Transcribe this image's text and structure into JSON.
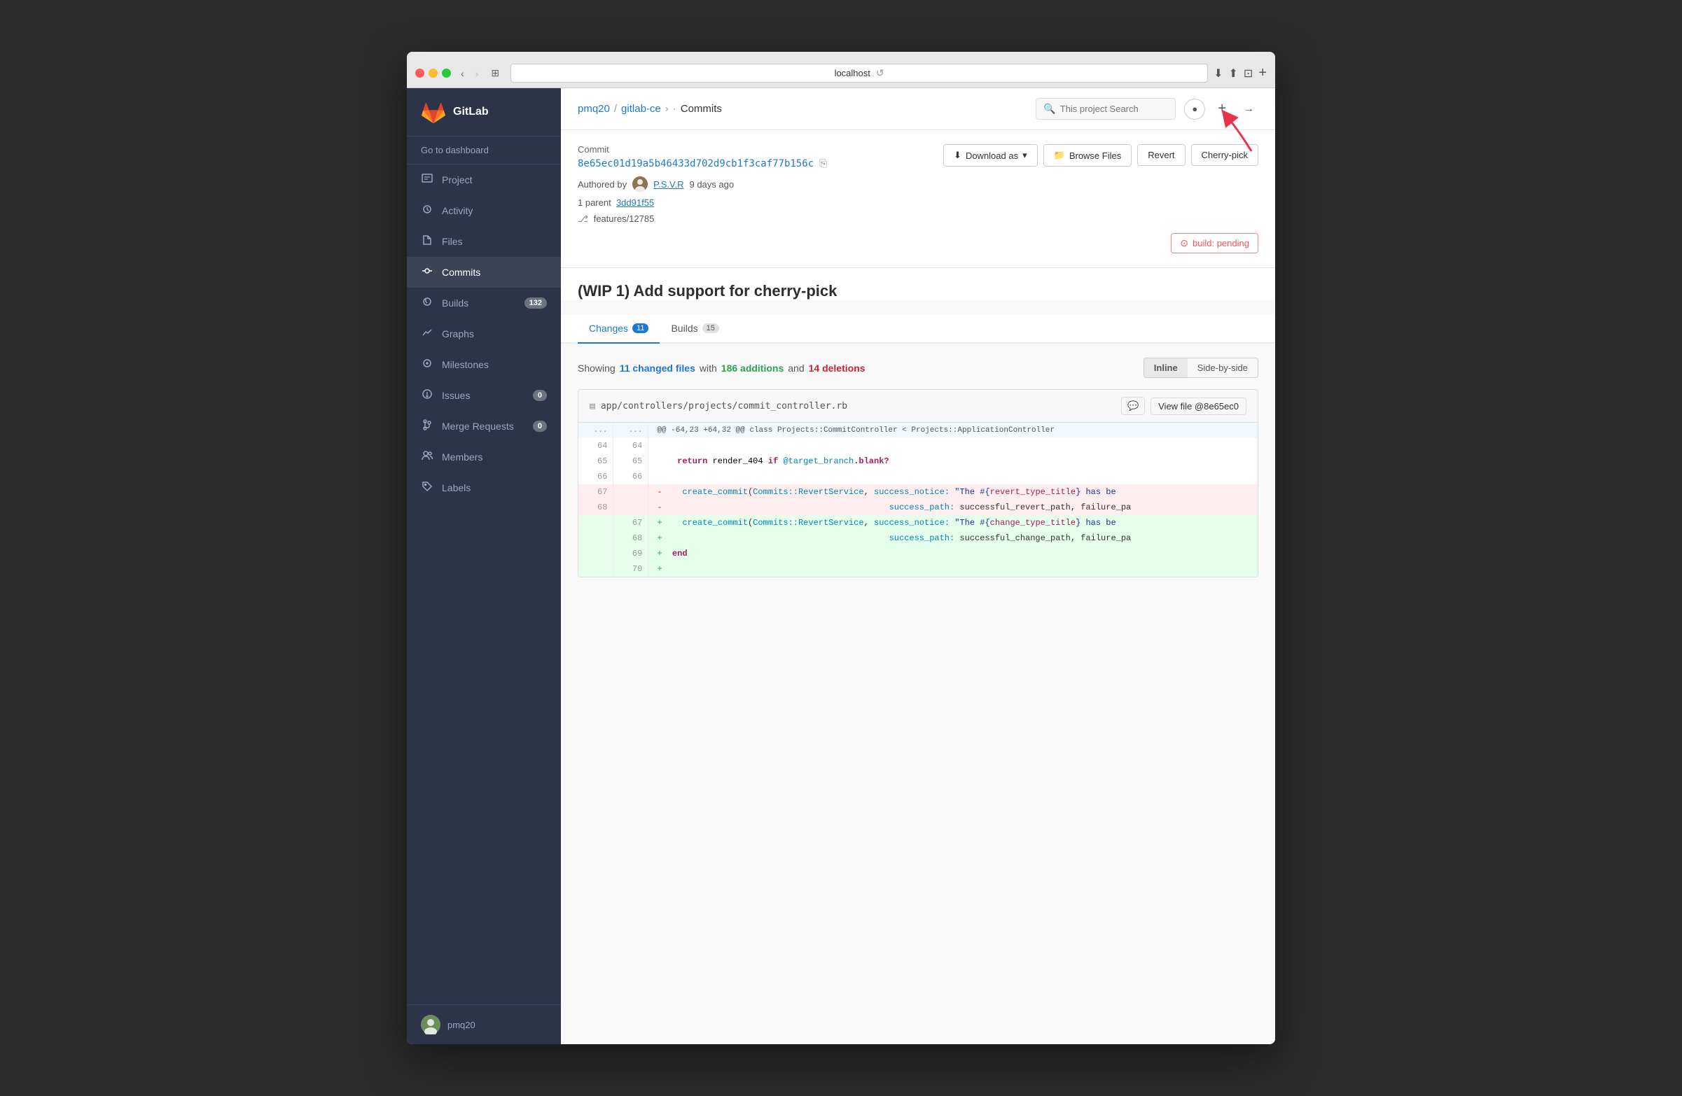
{
  "browser": {
    "url": "localhost",
    "back_disabled": false,
    "forward_disabled": true
  },
  "header": {
    "breadcrumb": {
      "user": "pmq20",
      "repo": "gitlab-ce",
      "page": "Commits"
    },
    "search_placeholder": "This project Search"
  },
  "commit": {
    "label": "Commit",
    "hash": "8e65ec01d19a5b46433d702d9cb1f3caf77b156c",
    "authored_by": "Authored by",
    "author": "P.S.V.R",
    "time_ago": "9 days ago",
    "parent_label": "1 parent",
    "parent_hash": "3dd91f55",
    "branch": "features/12785",
    "title": "(WIP 1) Add support for cherry-pick",
    "build_status": "build: pending"
  },
  "actions": {
    "download": "Download as",
    "browse": "Browse Files",
    "revert": "Revert",
    "cherry_pick": "Cherry-pick"
  },
  "tabs": [
    {
      "label": "Changes",
      "badge": "11",
      "active": true
    },
    {
      "label": "Builds",
      "badge": "15",
      "active": false
    }
  ],
  "diff_summary": {
    "prefix": "Showing",
    "changed_count": "11 changed files",
    "middle": "with",
    "additions": "186 additions",
    "and": "and",
    "deletions": "14 deletions"
  },
  "view_toggle": {
    "inline": "Inline",
    "side_by_side": "Side-by-side"
  },
  "file_diff": {
    "path": "app/controllers/projects/commit_controller.rb",
    "view_file": "View file @8e65ec0",
    "hunk": "@@ -64,23 +64,32 @@ class Projects::CommitController < Projects::ApplicationController",
    "lines": [
      {
        "type": "context",
        "old_num": "64",
        "new_num": "64",
        "code": ""
      },
      {
        "type": "context",
        "old_num": "65",
        "new_num": "65",
        "code": "    return render_404 if @target_branch.blank?"
      },
      {
        "type": "context",
        "old_num": "66",
        "new_num": "66",
        "code": ""
      },
      {
        "type": "del",
        "old_num": "67",
        "new_num": "",
        "code": "    create_commit(Commits::RevertService, success_notice: \"The #{revert_type_title} has be"
      },
      {
        "type": "del",
        "old_num": "68",
        "new_num": "",
        "code": "                                            success_path: successful_revert_path, failure_pa"
      },
      {
        "type": "add",
        "old_num": "",
        "new_num": "67",
        "code": "    create_commit(Commits::RevertService, success_notice: \"The #{change_type_title} has be"
      },
      {
        "type": "add",
        "old_num": "",
        "new_num": "68",
        "code": "                                            success_path: successful_change_path, failure_pa"
      },
      {
        "type": "add",
        "old_num": "",
        "new_num": "69",
        "code": "  end"
      },
      {
        "type": "add",
        "old_num": "",
        "new_num": "70",
        "code": "+"
      }
    ]
  },
  "sidebar": {
    "logo_text": "GitLab",
    "dashboard": "Go to dashboard",
    "items": [
      {
        "id": "project",
        "label": "Project",
        "icon": "📋",
        "badge": null
      },
      {
        "id": "activity",
        "label": "Activity",
        "icon": "📊",
        "badge": null
      },
      {
        "id": "files",
        "label": "Files",
        "icon": "📁",
        "badge": null
      },
      {
        "id": "commits",
        "label": "Commits",
        "icon": "🔄",
        "badge": null,
        "active": true
      },
      {
        "id": "builds",
        "label": "Builds",
        "icon": "⚙️",
        "badge": "132"
      },
      {
        "id": "graphs",
        "label": "Graphs",
        "icon": "📈",
        "badge": null
      },
      {
        "id": "milestones",
        "label": "Milestones",
        "icon": "⊙",
        "badge": null
      },
      {
        "id": "issues",
        "label": "Issues",
        "icon": "⚠️",
        "badge": "0"
      },
      {
        "id": "merge-requests",
        "label": "Merge Requests",
        "icon": "⇄",
        "badge": "0"
      },
      {
        "id": "members",
        "label": "Members",
        "icon": "👥",
        "badge": null
      },
      {
        "id": "labels",
        "label": "Labels",
        "icon": "🏷️",
        "badge": null
      }
    ],
    "user": "pmq20"
  }
}
